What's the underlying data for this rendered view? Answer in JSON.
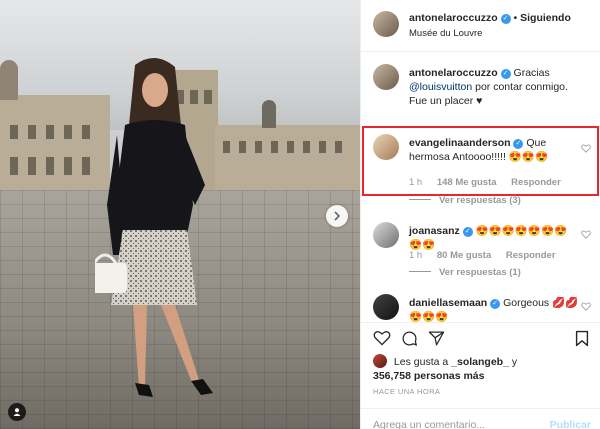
{
  "post_header": {
    "username": "antonelaroccuzzo",
    "follow_separator": "•",
    "follow_status": "Siguiendo",
    "location": "Musée du Louvre"
  },
  "caption": {
    "username": "antonelaroccuzzo",
    "text_before": "Gracias",
    "mention": "@louisvuitton",
    "text_after": "por contar conmigo. Fue un placer ♥"
  },
  "comments": [
    {
      "username": "evangelinaanderson",
      "text": "Que hermosa Antoooo!!!!! 😍😍😍",
      "time": "1 h",
      "likes": "148 Me gusta",
      "reply": "Responder",
      "view_replies": "Ver respuestas (3)"
    },
    {
      "username": "joanasanz",
      "text": "😍😍😍😍😍😍😍😍😍",
      "time": "1 h",
      "likes": "80 Me gusta",
      "reply": "Responder",
      "view_replies": "Ver respuestas (1)"
    },
    {
      "username": "daniellasemaan",
      "text": "Gorgeous 💋💋",
      "extra": "😍😍😍"
    }
  ],
  "likes_summary": {
    "prefix": "Les gusta a",
    "user": "_solangeb_",
    "conj": "y",
    "count": "356,758 personas más"
  },
  "timestamp": "HACE UNA HORA",
  "comment_box": {
    "placeholder": "Agrega un comentario...",
    "publish": "Publicar"
  },
  "colors": {
    "verified": "#3897f0",
    "highlight_border": "#e8262c",
    "link": "#003569"
  },
  "icons": {
    "like": "heart-icon",
    "comment": "comment-icon",
    "share": "share-icon",
    "save": "bookmark-icon"
  }
}
